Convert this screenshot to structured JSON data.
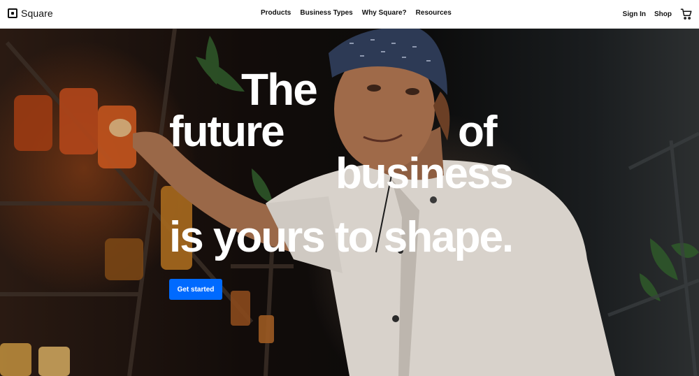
{
  "header": {
    "brand": "Square",
    "nav_items": [
      {
        "label": "Products"
      },
      {
        "label": "Business Types"
      },
      {
        "label": "Why Square?"
      },
      {
        "label": "Resources"
      }
    ],
    "sign_in": "Sign In",
    "shop": "Shop",
    "cart_icon": "cart-icon"
  },
  "hero": {
    "headline": {
      "word_the": "The",
      "word_future": "future",
      "word_of": "of",
      "word_business": "business",
      "line_shape": "is yours to shape."
    },
    "cta_label": "Get started"
  },
  "colors": {
    "cta": "#006aff",
    "text_dark": "#111111",
    "nav_bg": "#ffffff"
  }
}
